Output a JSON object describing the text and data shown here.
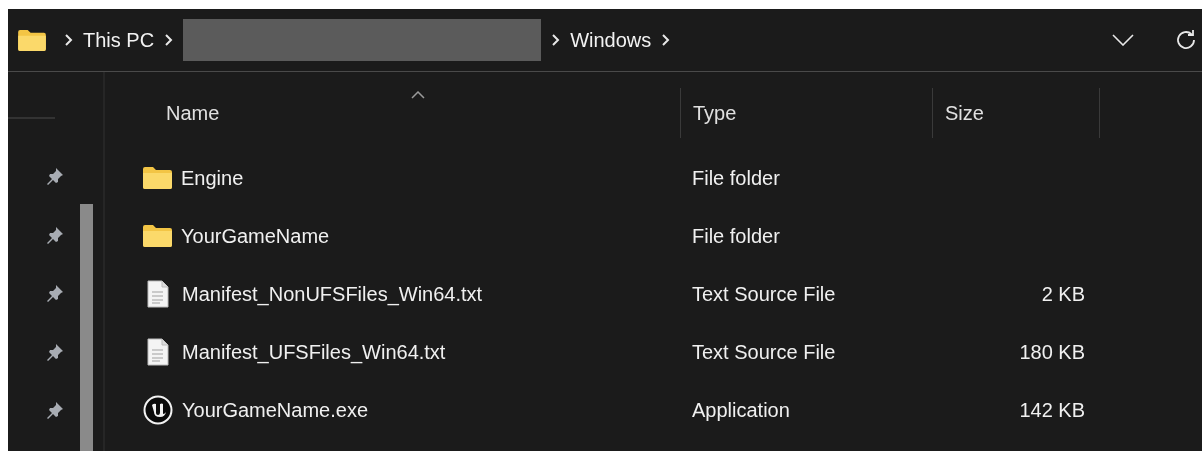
{
  "breadcrumb": {
    "segments": [
      {
        "kind": "text",
        "label": "This PC"
      },
      {
        "kind": "redacted"
      },
      {
        "kind": "text",
        "label": "Windows"
      }
    ]
  },
  "columns": [
    {
      "label": "Name",
      "sorted": true
    },
    {
      "label": "Type",
      "sorted": false
    },
    {
      "label": "Size",
      "sorted": false
    }
  ],
  "rows": [
    {
      "kind": "folder",
      "name": "Engine",
      "type": "File folder"
    },
    {
      "kind": "folder",
      "name": "YourGameName",
      "type": "File folder"
    },
    {
      "kind": "text",
      "name": "Manifest_NonUFSFiles_Win64.txt",
      "type": "Text Source File",
      "size": "2 KB"
    },
    {
      "kind": "text",
      "name": "Manifest_UFSFiles_Win64.txt",
      "type": "Text Source File",
      "size": "180 KB"
    },
    {
      "kind": "app",
      "name": "YourGameName.exe",
      "type": "Application",
      "size": "142 KB"
    }
  ]
}
